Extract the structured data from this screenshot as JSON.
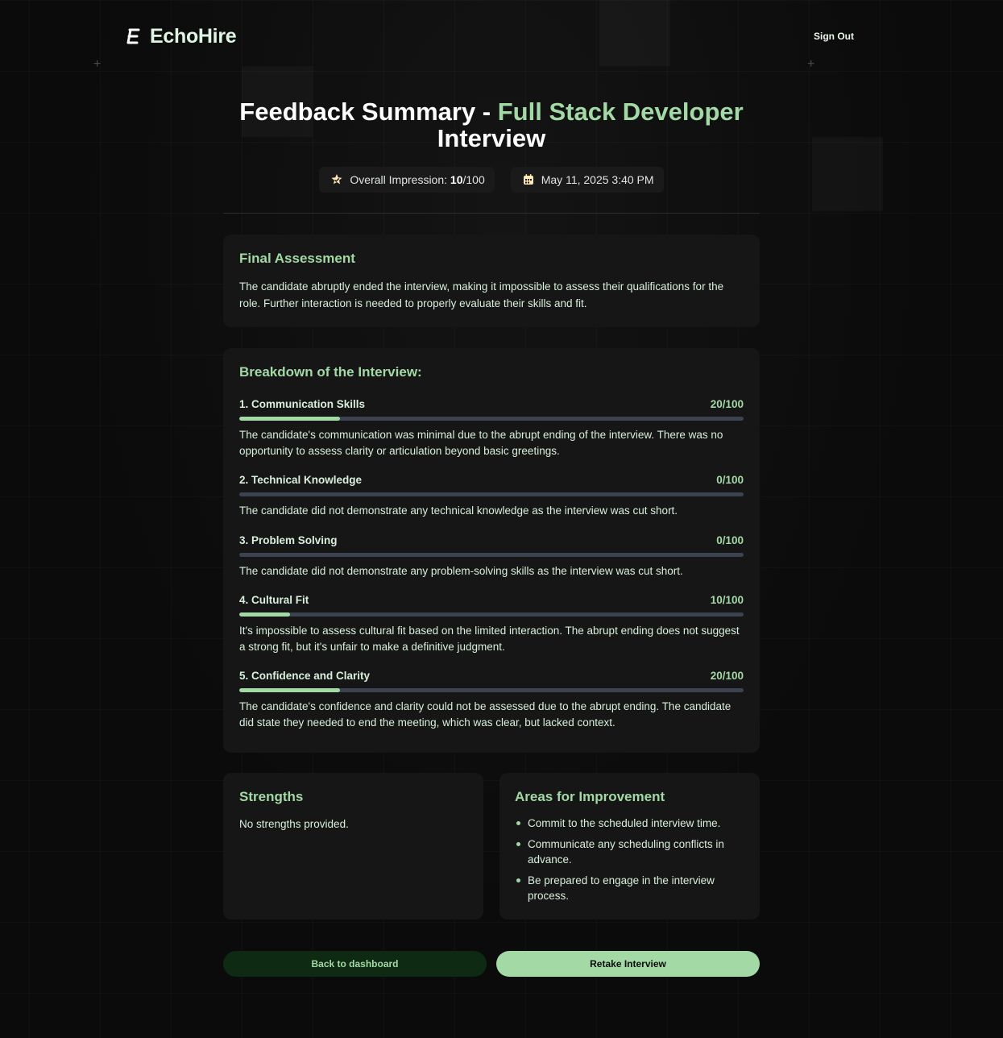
{
  "app": {
    "name": "EchoHire",
    "sign_out_label": "Sign Out"
  },
  "page": {
    "title_prefix": "Feedback Summary - ",
    "title_role": "Full Stack Developer",
    "title_suffix": "Interview"
  },
  "meta": {
    "impression_label": "Overall Impression: ",
    "impression_score": "10",
    "impression_max": "/100",
    "date": "May 11, 2025 3:40 PM"
  },
  "final_assessment": {
    "heading": "Final Assessment",
    "text": "The candidate abruptly ended the interview, making it impossible to assess their qualifications for the role. Further interaction is needed to properly evaluate their skills and fit."
  },
  "breakdown": {
    "heading": "Breakdown of the Interview:",
    "categories": [
      {
        "name": "1. Communication Skills",
        "score_text": "20/100",
        "score": 20,
        "comment": "The candidate's communication was minimal due to the abrupt ending of the interview. There was no opportunity to assess clarity or articulation beyond basic greetings."
      },
      {
        "name": "2. Technical Knowledge",
        "score_text": "0/100",
        "score": 0,
        "comment": "The candidate did not demonstrate any technical knowledge as the interview was cut short."
      },
      {
        "name": "3. Problem Solving",
        "score_text": "0/100",
        "score": 0,
        "comment": "The candidate did not demonstrate any problem-solving skills as the interview was cut short."
      },
      {
        "name": "4. Cultural Fit",
        "score_text": "10/100",
        "score": 10,
        "comment": "It's impossible to assess cultural fit based on the limited interaction. The abrupt ending does not suggest a strong fit, but it's unfair to make a definitive judgment."
      },
      {
        "name": "5. Confidence and Clarity",
        "score_text": "20/100",
        "score": 20,
        "comment": "The candidate's confidence and clarity could not be assessed due to the abrupt ending. The candidate did state they needed to end the meeting, which was clear, but lacked context."
      }
    ]
  },
  "strengths": {
    "heading": "Strengths",
    "empty_text": "No strengths provided."
  },
  "improvements": {
    "heading": "Areas for Improvement",
    "items": [
      "Commit to the scheduled interview time.",
      "Communicate any scheduling conflicts in advance.",
      "Be prepared to engage in the interview process."
    ]
  },
  "actions": {
    "back_label": "Back to dashboard",
    "retake_label": "Retake Interview"
  },
  "colors": {
    "accent": "#a3d9a5",
    "background": "#0b0b0b",
    "card": "#161616",
    "track": "#3b4350"
  },
  "icons": {
    "impression": "star-badge-icon",
    "date": "calendar-icon",
    "logo": "echohire-logo-icon"
  }
}
